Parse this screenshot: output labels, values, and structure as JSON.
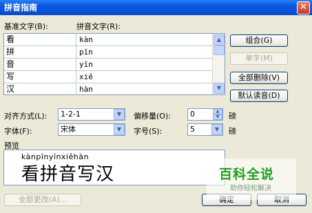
{
  "window": {
    "title": "拼音指南",
    "close_glyph": "✕"
  },
  "table": {
    "col_base_label": "基准文字(B):",
    "col_ruby_label": "拼音文字(R):",
    "rows": [
      {
        "base": "看",
        "ruby": "kàn"
      },
      {
        "base": "拼",
        "ruby": "pīn"
      },
      {
        "base": "音",
        "ruby": "yīn"
      },
      {
        "base": "写",
        "ruby": "xiě"
      },
      {
        "base": "汉",
        "ruby": "hàn"
      }
    ]
  },
  "buttons": {
    "group": "组合(G)",
    "mono": "单字(M)",
    "clear_all": "全部删除(V)",
    "default_reading": "默认读音(D)",
    "change_all": "全部更改(A)...",
    "ok": "确定",
    "cancel": "取消"
  },
  "options": {
    "alignment_label": "对齐方式(L):",
    "alignment_value": "1-2-1",
    "offset_label": "偏移量(O):",
    "offset_value": "0",
    "offset_unit": "磅",
    "font_label": "字体(F):",
    "font_value": "宋体",
    "size_label": "字号(S):",
    "size_value": "5",
    "size_unit": "磅"
  },
  "preview": {
    "label": "预览",
    "pinyin": "kànpīnyīnxiěhàn",
    "hanzi": "看拼音写汉"
  },
  "watermark": {
    "title": "百科全说",
    "subtitle": "助你轻松解决"
  }
}
